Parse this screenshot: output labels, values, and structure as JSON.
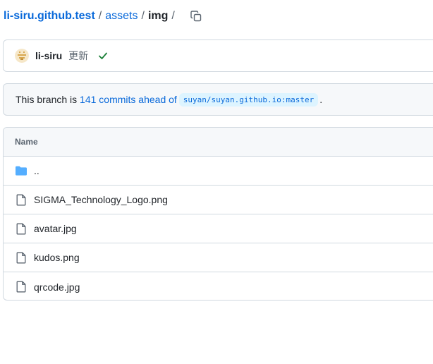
{
  "breadcrumb": {
    "repo": "li-siru.github.test",
    "folder": "assets",
    "current": "img",
    "separator": "/"
  },
  "commit": {
    "author": "li-siru",
    "message": "更新",
    "status": "success",
    "status_color": "#1a7f37"
  },
  "branch_banner": {
    "prefix": "This branch is ",
    "ahead_link": "141 commits ahead of",
    "upstream": "suyan/suyan.github.io:master",
    "suffix": "."
  },
  "file_table": {
    "header": "Name",
    "rows": [
      {
        "name": "..",
        "type": "folder",
        "icon": "folder-icon"
      },
      {
        "name": "SIGMA_Technology_Logo.png",
        "type": "file",
        "icon": "file-icon"
      },
      {
        "name": "avatar.jpg",
        "type": "file",
        "icon": "file-icon"
      },
      {
        "name": "kudos.png",
        "type": "file",
        "icon": "file-icon"
      },
      {
        "name": "qrcode.jpg",
        "type": "file",
        "icon": "file-icon"
      }
    ]
  },
  "colors": {
    "link": "#0969da",
    "folder": "#54aeff",
    "border": "#d1d9e0"
  }
}
